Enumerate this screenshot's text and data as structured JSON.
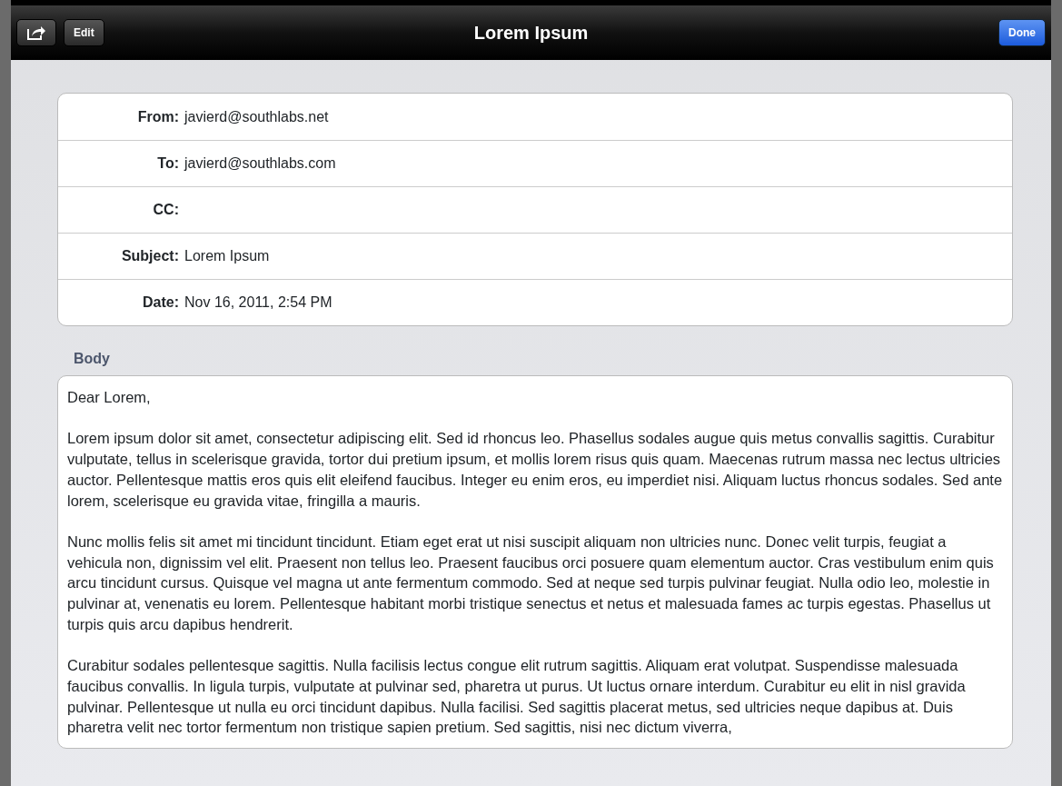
{
  "toolbar": {
    "title": "Lorem Ipsum",
    "buttons": [
      {
        "kind": "share"
      },
      {
        "kind": "text",
        "label": "Edit"
      }
    ],
    "done": "Done"
  },
  "headers": [
    {
      "label": "From:",
      "value": "javierd@southlabs.net"
    },
    {
      "label": "To:",
      "value": "javierd@southlabs.com"
    },
    {
      "label": "CC:"
    },
    {
      "label": "Subject:",
      "value": "Lorem Ipsum"
    },
    {
      "label": "Date:",
      "value": "Nov 16, 2011, 2:54 PM"
    }
  ],
  "body": {
    "heading": "Body",
    "paragraphs": [
      "Dear Lorem,",
      "Lorem ipsum dolor sit amet, consectetur adipiscing elit. Sed id rhoncus leo. Phasellus sodales augue quis metus convallis sagittis. Curabitur vulputate, tellus in scelerisque gravida, tortor dui pretium ipsum, et mollis lorem risus quis quam. Maecenas rutrum massa nec lectus ultricies auctor. Pellentesque mattis eros quis elit eleifend faucibus. Integer eu enim eros, eu imperdiet nisi. Aliquam luctus rhoncus sodales. Sed ante lorem, scelerisque eu gravida vitae, fringilla a mauris.",
      "Nunc mollis felis sit amet mi tincidunt tincidunt. Etiam eget erat ut nisi suscipit aliquam non ultricies nunc. Donec velit turpis, feugiat a vehicula non, dignissim vel elit. Praesent non tellus leo. Praesent faucibus orci posuere quam elementum auctor. Cras vestibulum enim quis arcu tincidunt cursus. Quisque vel magna ut ante fermentum commodo. Sed at neque sed turpis pulvinar feugiat. Nulla odio leo, molestie in pulvinar at, venenatis eu lorem. Pellentesque habitant morbi tristique senectus et netus et malesuada fames ac turpis egestas. Phasellus ut turpis quis arcu dapibus hendrerit.",
      "Curabitur sodales pellentesque sagittis. Nulla facilisis lectus congue elit rutrum sagittis. Aliquam erat volutpat. Suspendisse malesuada faucibus convallis. In ligula turpis, vulputate at pulvinar sed, pharetra ut purus. Ut luctus ornare interdum. Curabitur eu elit in nisl gravida pulvinar. Pellentesque ut nulla eu orci tincidunt dapibus. Nulla facilisi. Sed sagittis placerat metus, sed ultricies neque dapibus at. Duis pharetra velit nec tortor fermentum non tristique sapien pretium. Sed sagittis, nisi nec dictum viverra,"
    ]
  }
}
